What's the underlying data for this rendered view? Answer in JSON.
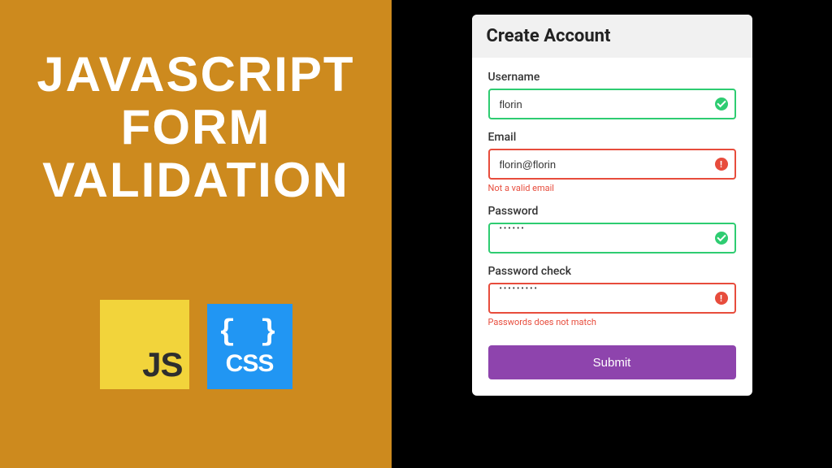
{
  "left": {
    "title_line1": "JavaScript",
    "title_line2": "Form",
    "title_line3": "Validation",
    "js_badge_label": "JS",
    "css_badge_braces": "{ }",
    "css_badge_label": "CSS"
  },
  "form": {
    "header_title": "Create Account",
    "fields": {
      "username": {
        "label": "Username",
        "value": "florin",
        "state": "success",
        "error": ""
      },
      "email": {
        "label": "Email",
        "value": "florin@florin",
        "state": "error",
        "error": "Not a valid email"
      },
      "password": {
        "label": "Password",
        "value_mask": "••••••",
        "state": "success",
        "error": ""
      },
      "password_check": {
        "label": "Password check",
        "value_mask": "•••••••••",
        "state": "error",
        "error": "Passwords does not match"
      }
    },
    "submit_label": "Submit"
  },
  "colors": {
    "left_bg": "#cd8a1e",
    "success": "#2ecc71",
    "error": "#e74c3c",
    "submit": "#8e44ad"
  }
}
